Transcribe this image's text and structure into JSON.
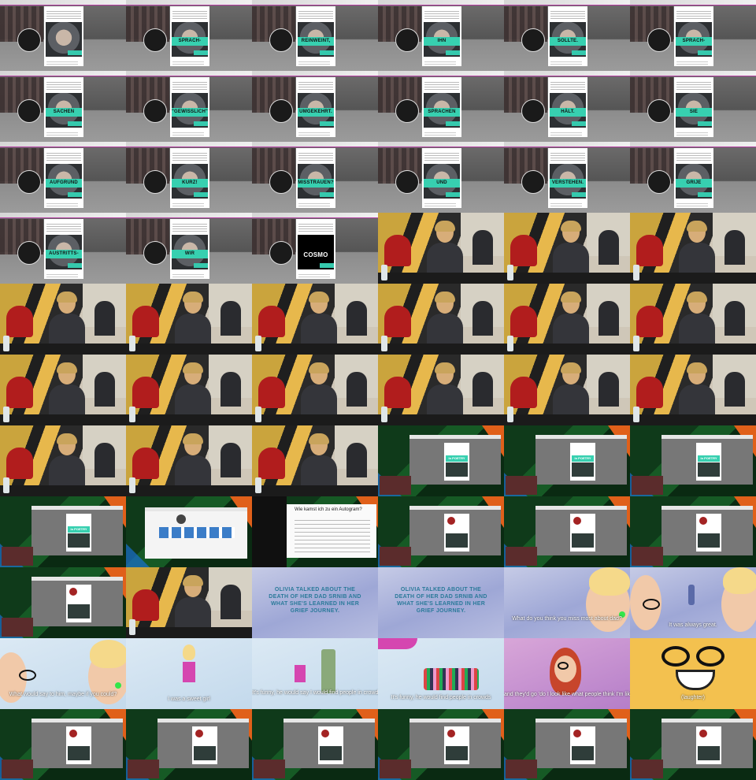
{
  "banner_words": [
    "SPRACH-",
    "REINWEINT,",
    "IHN",
    "SOLLTE.",
    "SPRACH-",
    "SACHEN",
    "\"GEWISSLICH\"",
    "UMGEKEHRT.",
    "SPRACHEN",
    "HÄLT.",
    "SIE",
    "AUFGRUND",
    "KURZ!",
    "MISSTRAUEN?",
    "UND",
    "VERSTEHEN.",
    "GRIJE",
    "AUSTRITTS-",
    "WIR"
  ],
  "end_logo": "COSMO",
  "call": {
    "post_banner": "In POETRY",
    "doc_title": "Wie kamst ich zu ein Autogram?"
  },
  "anim": {
    "title_text": "OLIVIA TALKED ABOUT THE DEATH OF HER DAD SRNIB AND WHAT SHE'S LEARNED IN HER GRIEF JOURNEY.",
    "q_dad": "What do you think you miss most about dad?",
    "always_great": "It was always great.",
    "say_to_him": "What would say to him, maybe if you could?",
    "i_was_a_sweet_girl": "I was a sweet girl",
    "funny_dad": "It's funny, he would say I would find people in crowds",
    "crowds": "It's funny, he would find people in crowds",
    "looks_like": "and they'd go 'do I look like what people think I'm like!'",
    "laughter": "(laughter)"
  }
}
